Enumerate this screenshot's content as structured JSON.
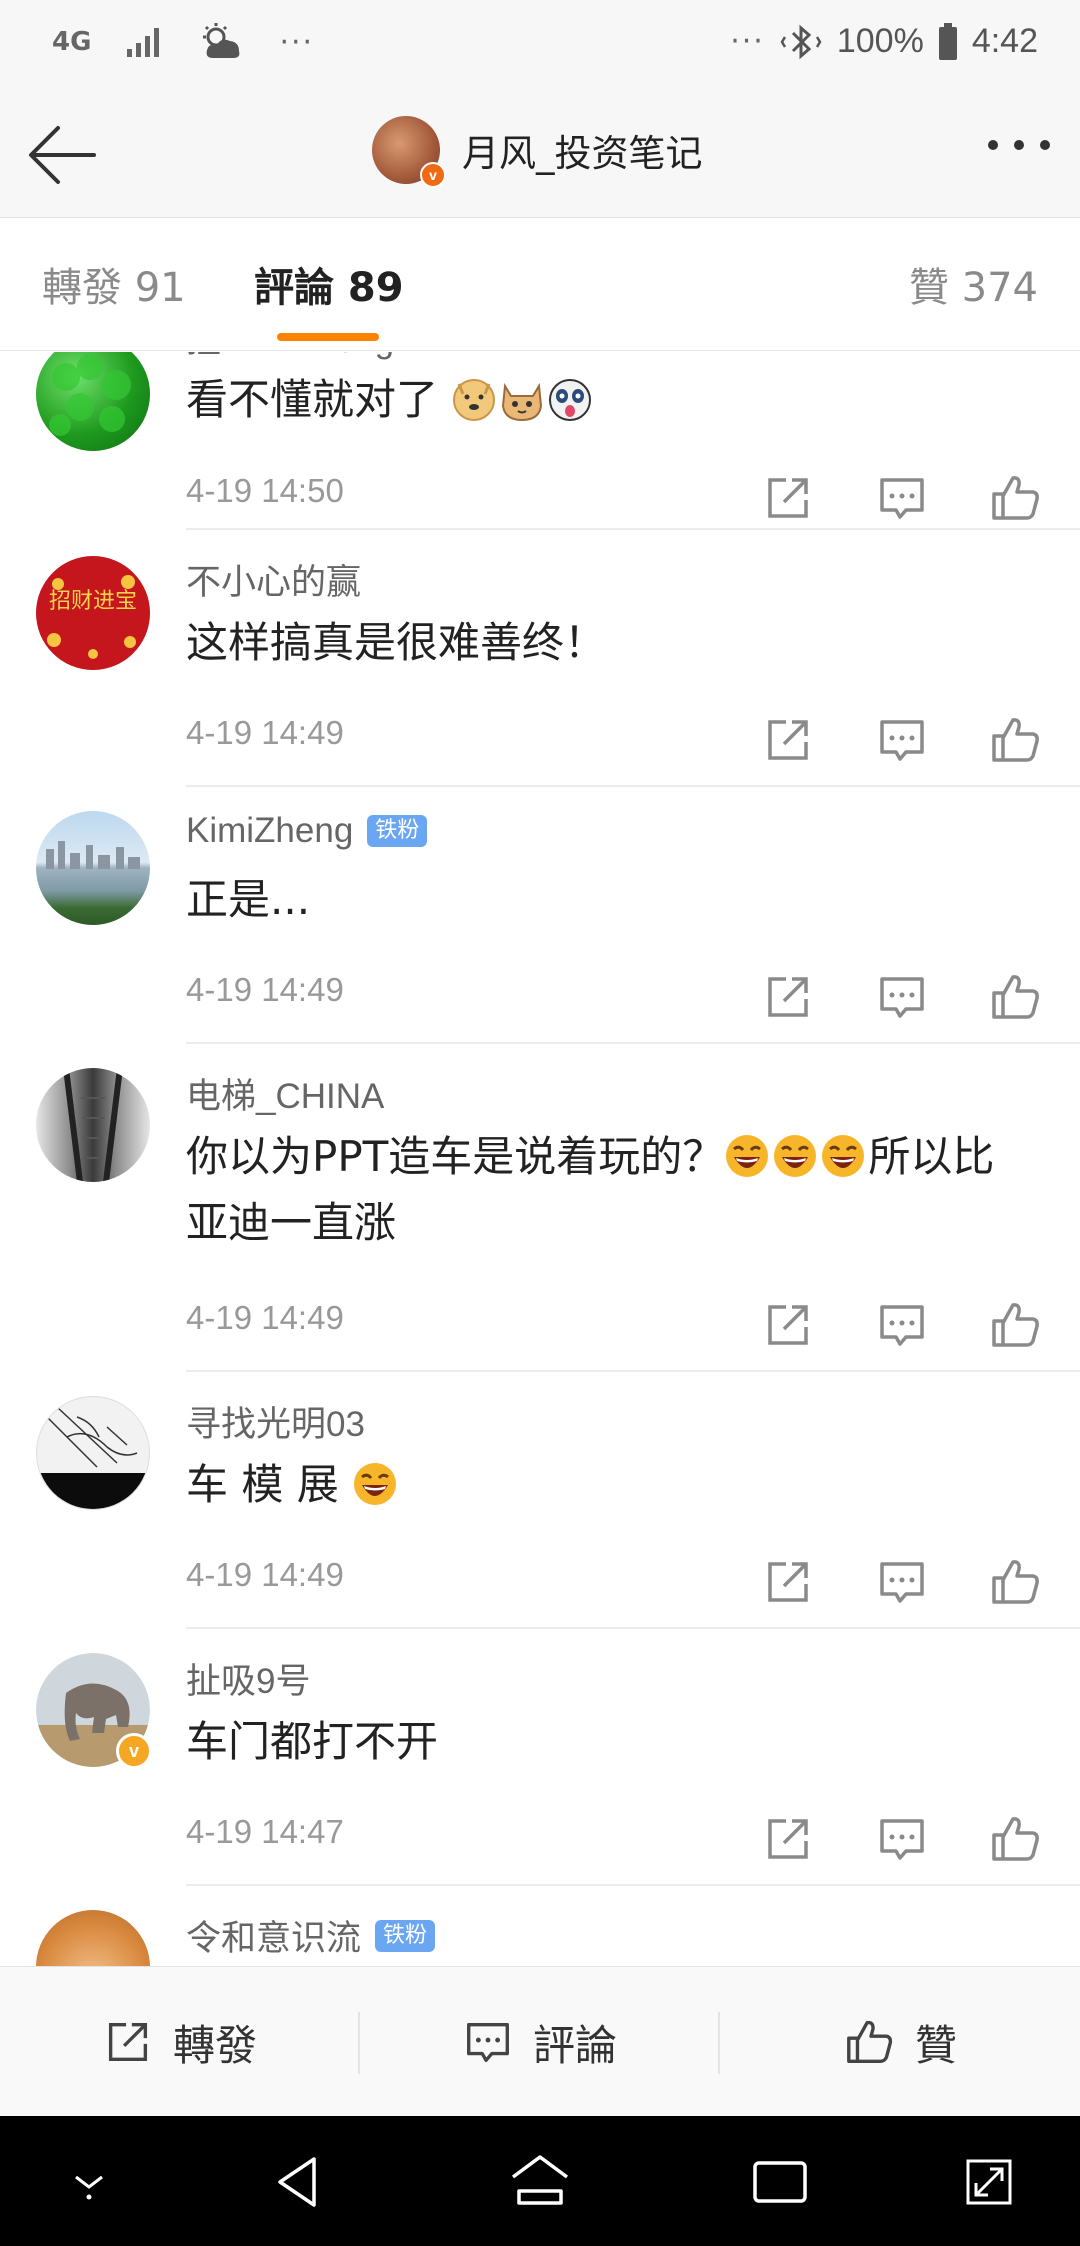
{
  "status_bar": {
    "network": "4G",
    "dots_left": "···",
    "dots_right": "···",
    "battery": "100%",
    "time": "4:42"
  },
  "header": {
    "title": "月风_投资笔记",
    "verified_mark": "v"
  },
  "tabs": {
    "reposts": "轉發 91",
    "comments": "評論 89",
    "likes": "贊 374"
  },
  "comments": [
    {
      "name": "扭 Kimizheng",
      "text": "看不懂就对了",
      "time": "4-19 14:50",
      "icon": "clover-avatar"
    },
    {
      "name": "不小心的赢",
      "text": "这样搞真是很难善终！",
      "time": "4-19 14:49",
      "icon": "fortune-avatar",
      "avatar_text": "招财进宝"
    },
    {
      "name": "KimiZheng",
      "badge": "铁粉",
      "text": "正是...",
      "time": "4-19 14:49",
      "icon": "skyline-avatar"
    },
    {
      "name": "电梯_CHINA",
      "text_line1": "你以为PPT造车是说着玩的？",
      "text_line1_end": "所以比",
      "text_line2": "亚迪一直涨",
      "time": "4-19 14:49",
      "icon": "escalator-avatar"
    },
    {
      "name": "寻找光明03",
      "text": "车 模 展",
      "time": "4-19 14:49",
      "icon": "sketch-avatar"
    },
    {
      "name": "扯吸9号",
      "text": "车门都打不开",
      "time": "4-19 14:47",
      "icon": "elephant-avatar",
      "verified_mark": "v"
    },
    {
      "name": "令和意识流",
      "badge": "铁粉",
      "icon": "cat-avatar"
    }
  ],
  "bottom_bar": {
    "repost": "轉發",
    "comment": "評論",
    "like": "贊"
  },
  "colors": {
    "accent": "#ff8200",
    "badge_blue": "#6ba6f2",
    "verified_orange": "#f06a13"
  }
}
